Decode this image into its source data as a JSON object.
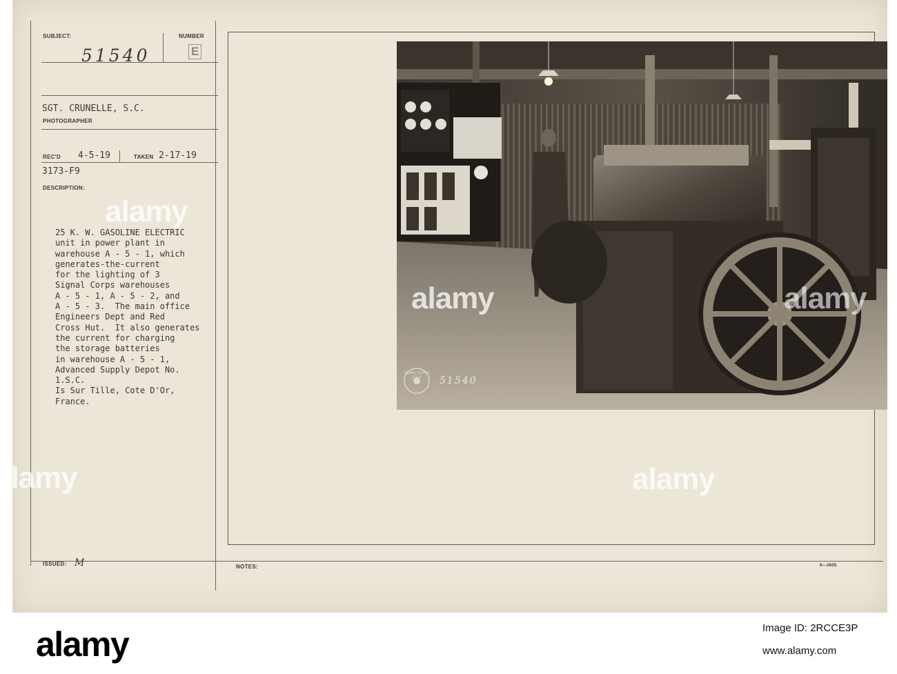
{
  "card": {
    "subject_label": "SUBJECT:",
    "subject_number": "51540",
    "number_label": "NUMBER",
    "number_value": "E",
    "photographer_name": "SGT. CRUNELLE, S.C.",
    "photographer_label": "PHOTOGRAPHER",
    "recd_label": "REC'D",
    "recd_date": "4-5-19",
    "taken_label": "TAKEN",
    "taken_date": "2-17-19",
    "file_code": "3173-F9",
    "description_label": "DESCRIPTION:",
    "description_lines": [
      "25 K. W. GASOLINE ELECTRIC",
      "unit in power plant in",
      "warehouse A - 5 - 1, which",
      "generates-the-current",
      "for the lighting of 3",
      "Signal Corps warehouses",
      "A - 5 - 1, A - 5 - 2, and",
      "A - 5 - 3.  The main office",
      "Engineers Dept and Red",
      "Cross Hut.  It also generates",
      "the current for charging",
      "the storage batteries",
      "in warehouse A - 5 - 1,",
      "Advanced Supply Depot No.",
      "1.S.C.",
      "Is Sur Tille, Cote D'Or,",
      "France."
    ],
    "issued_label": "ISSUED:",
    "issued_value": "M",
    "notes_label": "NOTES:",
    "form_number": "9—3605",
    "photo_stamp_number": "51540",
    "stamp_text": "SIGNAL CORPS U.S.A."
  },
  "watermark": "alamy",
  "footer": {
    "logo": "alamy",
    "image_id": "Image ID: 2RCCE3P",
    "url": "www.alamy.com"
  }
}
